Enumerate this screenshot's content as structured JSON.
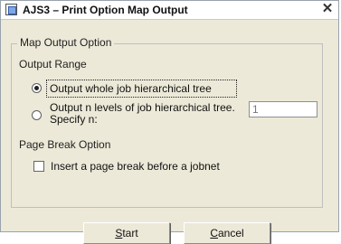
{
  "titlebar": {
    "app_icon": "app-window-icon",
    "title": "AJS3 – Print Option Map Output",
    "close_icon": "close-icon",
    "close_glyph": "✕"
  },
  "group": {
    "legend": "Map Output Option",
    "output_range_label": "Output Range",
    "options": [
      {
        "label": "Output whole job hierarchical tree",
        "selected": true
      },
      {
        "label_line1": "Output n levels of job hierarchical tree.",
        "label_line2": "Specify n:",
        "selected": false
      }
    ],
    "levels_value": "1",
    "page_break_label": "Page Break Option",
    "page_break_checkbox_label": "Insert a page break before a jobnet",
    "page_break_checked": false
  },
  "buttons": {
    "start_mnemonic": "S",
    "start_rest": "tart",
    "cancel_mnemonic": "C",
    "cancel_rest": "ancel"
  }
}
